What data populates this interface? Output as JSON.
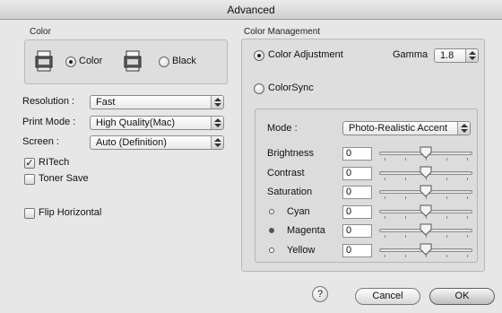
{
  "window": {
    "title": "Advanced"
  },
  "color_group": {
    "label": "Color",
    "option_color": "Color",
    "option_black": "Black",
    "selected": "Color"
  },
  "settings": {
    "resolution_label": "Resolution :",
    "resolution_value": "Fast",
    "print_mode_label": "Print Mode :",
    "print_mode_value": "High Quality(Mac)",
    "screen_label": "Screen :",
    "screen_value": "Auto (Definition)"
  },
  "checks": {
    "ritech_label": "RITech",
    "ritech_checked": true,
    "toner_label": "Toner Save",
    "toner_checked": false,
    "flip_label": "Flip Horizontal",
    "flip_checked": false
  },
  "color_management": {
    "label": "Color Management",
    "color_adjustment_label": "Color Adjustment",
    "colorsync_label": "ColorSync",
    "selected": "Color Adjustment",
    "gamma_label": "Gamma",
    "gamma_value": "1.8",
    "mode_label": "Mode :",
    "mode_value": "Photo-Realistic Accent",
    "sliders": [
      {
        "label": "Brightness",
        "value": "0",
        "level": 0
      },
      {
        "label": "Contrast",
        "value": "0",
        "level": 0
      },
      {
        "label": "Saturation",
        "value": "0",
        "level": 0
      },
      {
        "label": "Cyan",
        "value": "0",
        "level": 0,
        "dot": "hollow"
      },
      {
        "label": "Magenta",
        "value": "0",
        "level": 0,
        "dot": "filled"
      },
      {
        "label": "Yellow",
        "value": "0",
        "level": 0,
        "dot": "hollow"
      }
    ]
  },
  "buttons": {
    "help": "?",
    "cancel": "Cancel",
    "ok": "OK"
  },
  "icons": {
    "printer_color": "printer-icon",
    "printer_black": "printer-icon",
    "help": "help-icon"
  }
}
